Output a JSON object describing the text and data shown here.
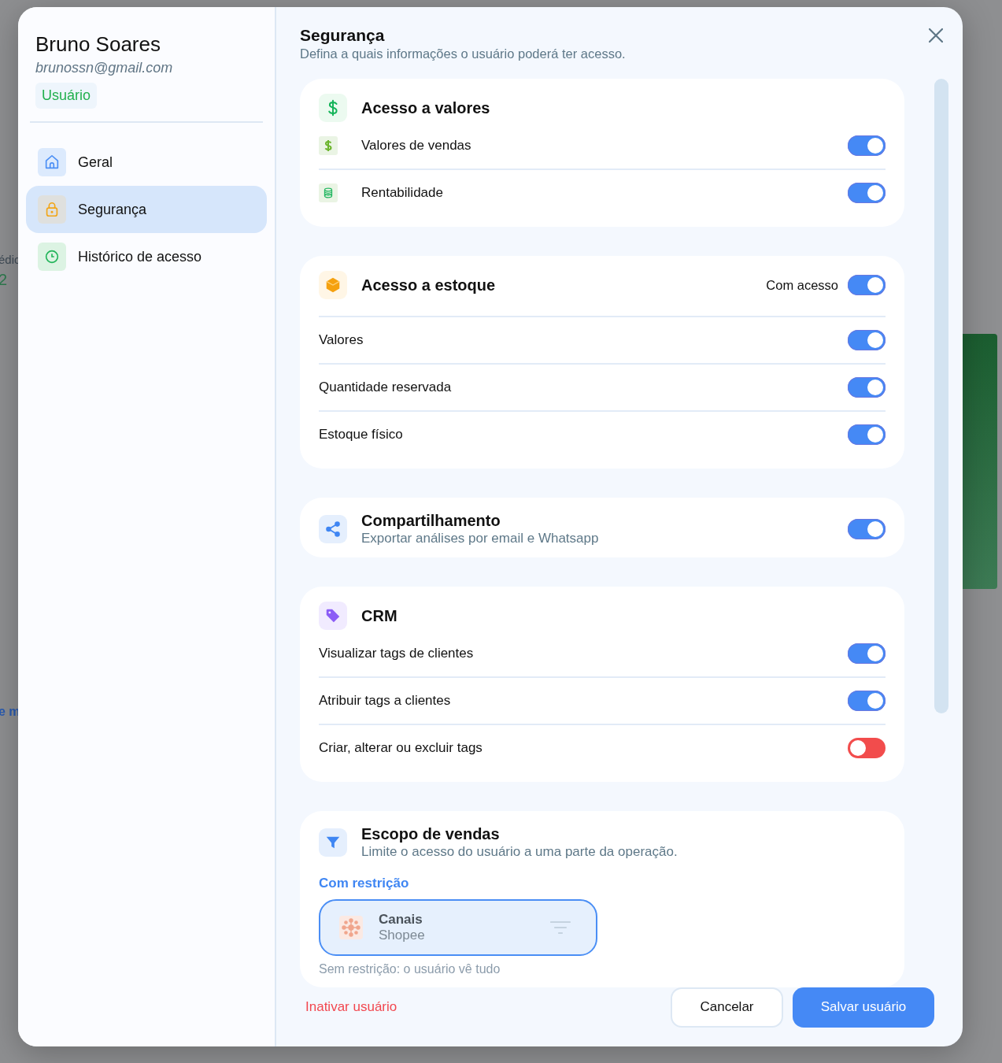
{
  "backdrop": {
    "fragments": [
      "édic",
      "2",
      "e m"
    ]
  },
  "user": {
    "name": "Bruno Soares",
    "email": "brunossn@gmail.com",
    "role": "Usuário"
  },
  "nav": [
    {
      "label": "Geral",
      "selected": false
    },
    {
      "label": "Segurança",
      "selected": true
    },
    {
      "label": "Histórico de acesso",
      "selected": false
    }
  ],
  "panel": {
    "title": "Segurança",
    "subtitle": "Defina a quais informações o usuário poderá ter acesso."
  },
  "sections": [
    {
      "kind": "list",
      "title": "Acesso a valores",
      "items": [
        {
          "label": "Valores de vendas",
          "on": true
        },
        {
          "label": "Rentabilidade",
          "on": true
        }
      ]
    },
    {
      "kind": "list",
      "title": "Acesso a estoque",
      "status": "Com acesso",
      "on": true,
      "items": [
        {
          "label": "Valores",
          "on": true
        },
        {
          "label": "Quantidade reservada",
          "on": true
        },
        {
          "label": "Estoque físico",
          "on": true
        }
      ]
    },
    {
      "kind": "single",
      "title": "Compartilhamento",
      "subtitle": "Exportar análises por email e Whatsapp",
      "on": true
    },
    {
      "kind": "list",
      "title": "CRM",
      "items": [
        {
          "label": "Visualizar tags de clientes",
          "on": true
        },
        {
          "label": "Atribuir tags a clientes",
          "on": true
        },
        {
          "label": "Criar, alterar ou excluir tags",
          "on": false
        }
      ]
    },
    {
      "kind": "scope",
      "title": "Escopo de vendas",
      "subtitle": "Limite o acesso do usuário a uma parte da operação.",
      "restriction": "Com restrição",
      "filter": {
        "title": "Canais",
        "value": "Shopee"
      },
      "note": "Sem restrição: o usuário vê tudo"
    }
  ],
  "footer": {
    "deactivate": "Inativar usuário",
    "cancel": "Cancelar",
    "save": "Salvar usuário"
  }
}
